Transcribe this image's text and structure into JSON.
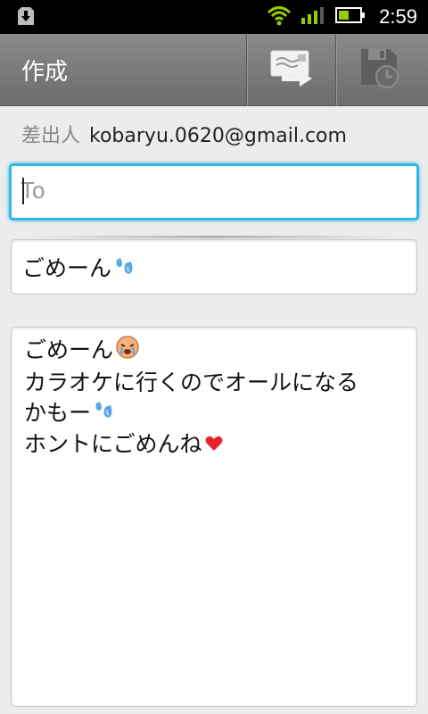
{
  "status_bar": {
    "time": "2:59",
    "icons": [
      "download-notification-icon",
      "wifi-icon",
      "signal-icon",
      "battery-icon"
    ]
  },
  "action_bar": {
    "title": "作成",
    "buttons": [
      {
        "name": "send-icon"
      },
      {
        "name": "save-draft-icon"
      }
    ]
  },
  "from": {
    "label": "差出人",
    "value": "kobaryu.0620@gmail.com"
  },
  "to": {
    "placeholder": "To",
    "value": ""
  },
  "subject": {
    "value": "ごめーん",
    "emoji": "sweat-drop-emoji"
  },
  "body": {
    "lines": [
      {
        "text": "ごめーん",
        "emoji": "crying-face-emoji"
      },
      {
        "text": "カラオケに行くのでオールになる",
        "emoji": ""
      },
      {
        "text": "かもー",
        "emoji": "sweat-drop-emoji"
      },
      {
        "text": "ホントにごめんね",
        "emoji": "heart-emoji"
      }
    ]
  },
  "colors": {
    "focus_accent": "#33b5e5",
    "action_bar": "#7a7a7a",
    "signal_green": "#99cc00",
    "background": "#ececec"
  }
}
